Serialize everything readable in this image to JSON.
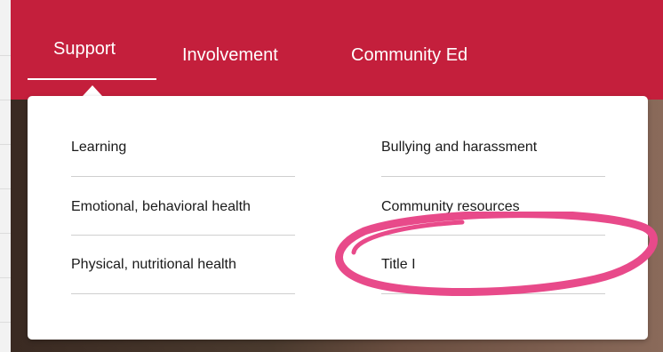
{
  "nav": {
    "items": [
      {
        "label": "Support",
        "active": true
      },
      {
        "label": "Involvement",
        "active": false
      },
      {
        "label": "Community Ed",
        "active": false
      }
    ]
  },
  "dropdown": {
    "left_column": [
      {
        "label": "Learning"
      },
      {
        "label": "Emotional, behavioral health"
      },
      {
        "label": "Physical, nutritional health"
      }
    ],
    "right_column": [
      {
        "label": "Bullying and harassment"
      },
      {
        "label": "Community resources"
      },
      {
        "label": "Title I",
        "highlighted": true
      }
    ]
  },
  "colors": {
    "nav_background": "#c41f3c",
    "highlight_annotation": "#e84a8a"
  },
  "icons": [
    "caret-up-icon"
  ]
}
